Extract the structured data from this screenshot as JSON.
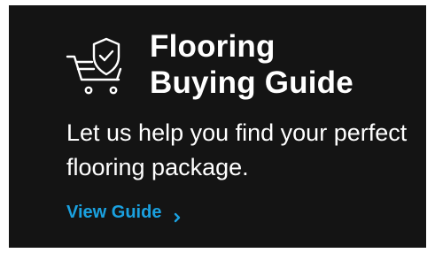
{
  "card": {
    "title_line1": "Flooring",
    "title_line2": "Buying Guide",
    "description": "Let us help you find your perfect flooring package.",
    "cta_label": "View Guide",
    "icon": "cart-shield-check-icon",
    "chevron_icon": "chevron-right-icon"
  },
  "colors": {
    "background": "#141414",
    "text": "#ffffff",
    "accent": "#1aa1e0"
  }
}
